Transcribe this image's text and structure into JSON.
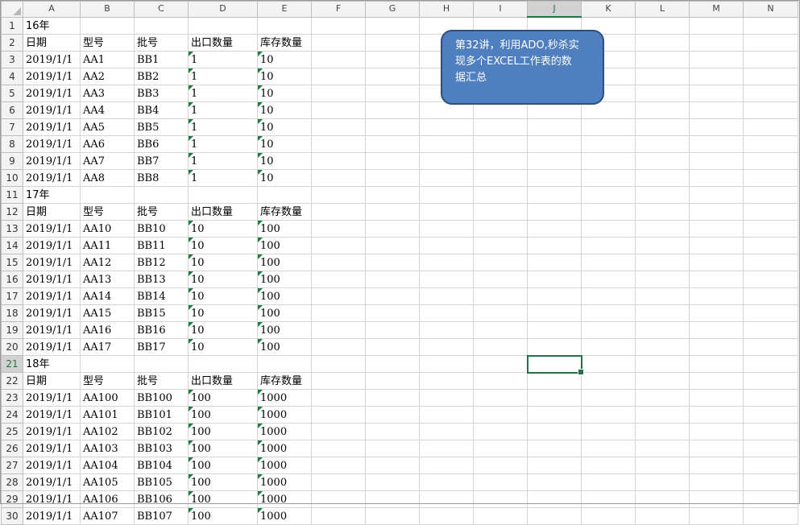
{
  "columns": [
    "A",
    "B",
    "C",
    "D",
    "E",
    "F",
    "G",
    "H",
    "I",
    "J",
    "K",
    "L",
    "M",
    "N"
  ],
  "active_column": "J",
  "active_row": 21,
  "rows": [
    {
      "num": 1,
      "cells": [
        "16年",
        "",
        "",
        "",
        ""
      ]
    },
    {
      "num": 2,
      "cells": [
        "日期",
        "型号",
        "批号",
        "出口数量",
        "库存数量"
      ]
    },
    {
      "num": 3,
      "cells": [
        "2019/1/1",
        "AA1",
        "BB1",
        "1",
        "10"
      ]
    },
    {
      "num": 4,
      "cells": [
        "2019/1/1",
        "AA2",
        "BB2",
        "1",
        "10"
      ]
    },
    {
      "num": 5,
      "cells": [
        "2019/1/1",
        "AA3",
        "BB3",
        "1",
        "10"
      ]
    },
    {
      "num": 6,
      "cells": [
        "2019/1/1",
        "AA4",
        "BB4",
        "1",
        "10"
      ]
    },
    {
      "num": 7,
      "cells": [
        "2019/1/1",
        "AA5",
        "BB5",
        "1",
        "10"
      ]
    },
    {
      "num": 8,
      "cells": [
        "2019/1/1",
        "AA6",
        "BB6",
        "1",
        "10"
      ]
    },
    {
      "num": 9,
      "cells": [
        "2019/1/1",
        "AA7",
        "BB7",
        "1",
        "10"
      ]
    },
    {
      "num": 10,
      "cells": [
        "2019/1/1",
        "AA8",
        "BB8",
        "1",
        "10"
      ]
    },
    {
      "num": 11,
      "cells": [
        "17年",
        "",
        "",
        "",
        ""
      ]
    },
    {
      "num": 12,
      "cells": [
        "日期",
        "型号",
        "批号",
        "出口数量",
        "库存数量"
      ]
    },
    {
      "num": 13,
      "cells": [
        "2019/1/1",
        "AA10",
        "BB10",
        "10",
        "100"
      ]
    },
    {
      "num": 14,
      "cells": [
        "2019/1/1",
        "AA11",
        "BB11",
        "10",
        "100"
      ]
    },
    {
      "num": 15,
      "cells": [
        "2019/1/1",
        "AA12",
        "BB12",
        "10",
        "100"
      ]
    },
    {
      "num": 16,
      "cells": [
        "2019/1/1",
        "AA13",
        "BB13",
        "10",
        "100"
      ]
    },
    {
      "num": 17,
      "cells": [
        "2019/1/1",
        "AA14",
        "BB14",
        "10",
        "100"
      ]
    },
    {
      "num": 18,
      "cells": [
        "2019/1/1",
        "AA15",
        "BB15",
        "10",
        "100"
      ]
    },
    {
      "num": 19,
      "cells": [
        "2019/1/1",
        "AA16",
        "BB16",
        "10",
        "100"
      ]
    },
    {
      "num": 20,
      "cells": [
        "2019/1/1",
        "AA17",
        "BB17",
        "10",
        "100"
      ]
    },
    {
      "num": 21,
      "cells": [
        "18年",
        "",
        "",
        "",
        ""
      ]
    },
    {
      "num": 22,
      "cells": [
        "日期",
        "型号",
        "批号",
        "出口数量",
        "库存数量"
      ]
    },
    {
      "num": 23,
      "cells": [
        "2019/1/1",
        "AA100",
        "BB100",
        "100",
        "1000"
      ]
    },
    {
      "num": 24,
      "cells": [
        "2019/1/1",
        "AA101",
        "BB101",
        "100",
        "1000"
      ]
    },
    {
      "num": 25,
      "cells": [
        "2019/1/1",
        "AA102",
        "BB102",
        "100",
        "1000"
      ]
    },
    {
      "num": 26,
      "cells": [
        "2019/1/1",
        "AA103",
        "BB103",
        "100",
        "1000"
      ]
    },
    {
      "num": 27,
      "cells": [
        "2019/1/1",
        "AA104",
        "BB104",
        "100",
        "1000"
      ]
    },
    {
      "num": 28,
      "cells": [
        "2019/1/1",
        "AA105",
        "BB105",
        "100",
        "1000"
      ]
    },
    {
      "num": 29,
      "cells": [
        "2019/1/1",
        "AA106",
        "BB106",
        "100",
        "1000"
      ]
    },
    {
      "num": 30,
      "cells": [
        "2019/1/1",
        "AA107",
        "BB107",
        "100",
        "1000"
      ]
    }
  ],
  "callout": {
    "lines": [
      "第32讲，利用ADO,秒杀实",
      "现多个EXCEL工作表的数",
      "据汇总"
    ]
  },
  "colors": {
    "accent_green": "#217346",
    "callout_fill": "#4f7fbf",
    "callout_border": "#2f4f7f"
  }
}
